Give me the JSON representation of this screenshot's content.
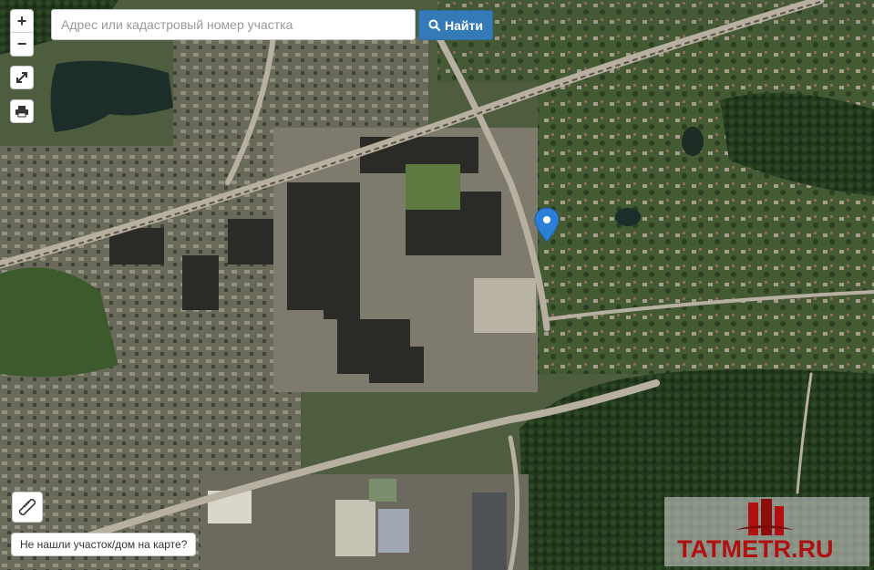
{
  "map": {
    "type": "satellite",
    "colors": {
      "forest": "#21391b",
      "field": "#55703f",
      "urban": "#6f6d5f",
      "road": "#b9b2a2",
      "water": "#1d2e2a",
      "marker": "#2b7fd6"
    }
  },
  "controls": {
    "zoom_in_label": "+",
    "zoom_out_label": "−",
    "fullscreen_icon": "expand-icon",
    "print_icon": "print-icon",
    "ruler_icon": "ruler-icon"
  },
  "search": {
    "placeholder": "Адрес или кадастровый номер участка",
    "value": "",
    "button_label": "Найти"
  },
  "not_found_link": "Не нашли участок/дом на карте?",
  "marker": {
    "icon": "map-pin-icon"
  },
  "watermark": {
    "text": "TATMETR.RU"
  }
}
